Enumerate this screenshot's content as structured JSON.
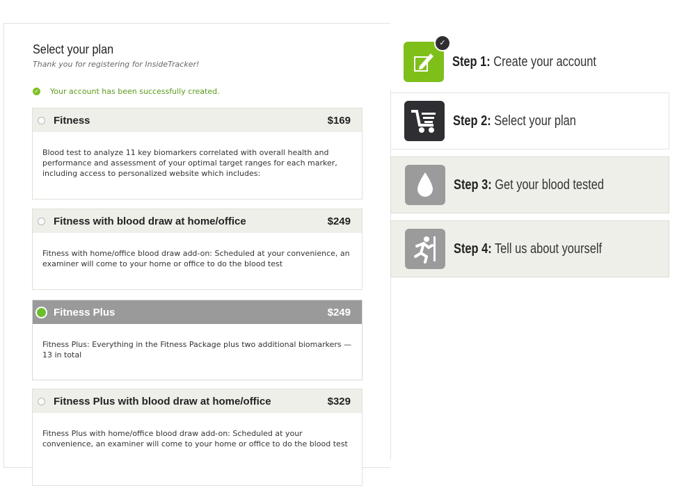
{
  "header": {
    "title": "Select your plan",
    "subtitle": "Thank you for registering for InsideTracker!"
  },
  "status": {
    "success_message": "Your account has been successfully created.",
    "success_color": "#5a9a1a"
  },
  "plans": [
    {
      "name": "Fitness",
      "price": "$169",
      "selected": false,
      "description": "Blood test to analyze 11 key biomarkers correlated with overall health and performance and assessment of your optimal target ranges for each marker, including access to personalized website which includes:"
    },
    {
      "name": "Fitness with blood draw at home/office",
      "price": "$249",
      "selected": false,
      "description": "Fitness with home/office blood draw add-on: Scheduled at your convenience, an examiner will come to your home or office to do the blood test"
    },
    {
      "name": "Fitness Plus",
      "price": "$249",
      "selected": true,
      "description": "Fitness Plus: Everything in the Fitness Package plus two additional biomarkers — 13 in total"
    },
    {
      "name": "Fitness Plus with blood draw at home/office",
      "price": "$329",
      "selected": false,
      "description": "Fitness Plus with home/office blood draw add-on: Scheduled at your convenience, an examiner will come to your home or office to do the blood test"
    }
  ],
  "steps": [
    {
      "prefix": "Step 1:",
      "label": "Create your account",
      "icon": "edit-icon",
      "completed": true,
      "icon_color": "#7fbf1a"
    },
    {
      "prefix": "Step 2:",
      "label": "Select your plan",
      "icon": "cart-icon",
      "completed": false,
      "icon_color": "#2f2f33"
    },
    {
      "prefix": "Step 3:",
      "label": "Get your blood tested",
      "icon": "blood-drop-icon",
      "completed": false,
      "icon_color": "#9b9b9b"
    },
    {
      "prefix": "Step 4:",
      "label": "Tell us about yourself",
      "icon": "runner-icon",
      "completed": false,
      "icon_color": "#9b9b9b"
    }
  ]
}
